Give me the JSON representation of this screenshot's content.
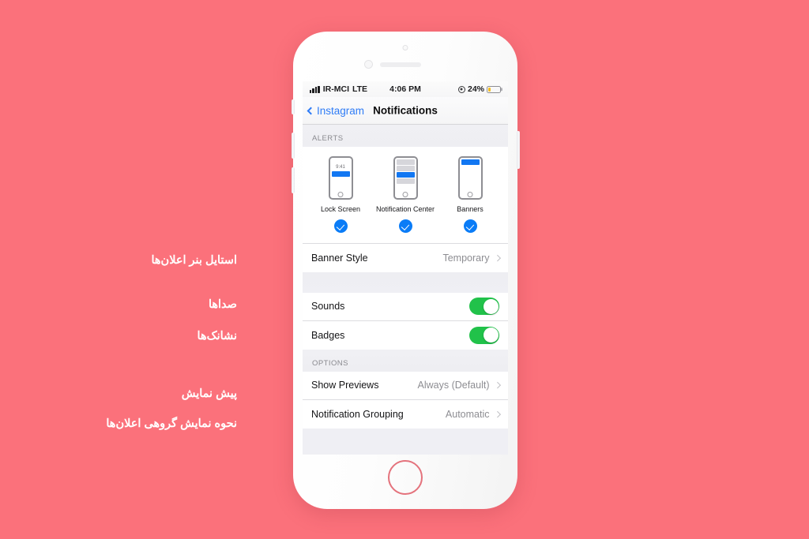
{
  "theme": {
    "background_color": "#fb717b",
    "accent_blue": "#0a7cf7",
    "toggle_green": "#21c24a",
    "battery_yellow": "#f5bd1f"
  },
  "annotations": [
    {
      "id": "banner-style",
      "text": "استایل بنر اعلان‌ها"
    },
    {
      "id": "sounds",
      "text": "صداها"
    },
    {
      "id": "badges",
      "text": "نشانک‌ها"
    },
    {
      "id": "show-previews",
      "text": "پیش نمایش"
    },
    {
      "id": "notification-grouping",
      "text": "نحوه نمایش گروهی اعلان‌ها"
    }
  ],
  "status_bar": {
    "carrier": "IR-MCI",
    "network": "LTE",
    "time": "4:06 PM",
    "battery_percent": "24%",
    "battery_level": 24,
    "low_power_icon": "low-power-icon",
    "signal_icon": "signal-bars-icon"
  },
  "nav_bar": {
    "back_label": "Instagram",
    "back_icon": "chevron-left-icon",
    "title": "Notifications"
  },
  "sections": {
    "alerts": {
      "header": "ALERTS",
      "options": [
        {
          "label": "Lock Screen",
          "mock_time": "9:41",
          "checked": true
        },
        {
          "label": "Notification Center",
          "mock_time": "",
          "checked": true
        },
        {
          "label": "Banners",
          "mock_time": "",
          "checked": true
        }
      ],
      "banner_style": {
        "label": "Banner Style",
        "value": "Temporary",
        "chevron_icon": "chevron-right-icon"
      }
    },
    "switches": [
      {
        "label": "Sounds",
        "on": true
      },
      {
        "label": "Badges",
        "on": true
      }
    ],
    "options": {
      "header": "OPTIONS",
      "rows": [
        {
          "label": "Show Previews",
          "value": "Always (Default)",
          "chevron_icon": "chevron-right-icon"
        },
        {
          "label": "Notification Grouping",
          "value": "Automatic",
          "chevron_icon": "chevron-right-icon"
        }
      ]
    }
  }
}
